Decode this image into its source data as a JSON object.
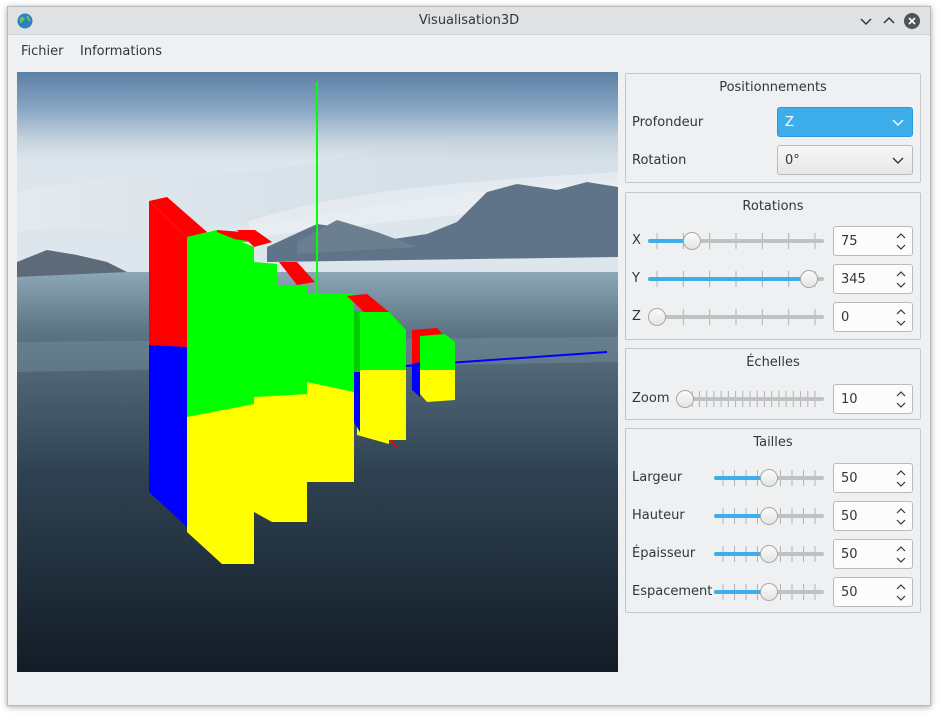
{
  "window": {
    "title": "Visualisation3D"
  },
  "menu": {
    "items": [
      "Fichier",
      "Informations"
    ]
  },
  "positionnements": {
    "title": "Positionnements",
    "profondeur": {
      "label": "Profondeur",
      "value": "Z"
    },
    "rotation": {
      "label": "Rotation",
      "value": "0°"
    }
  },
  "rotations": {
    "title": "Rotations",
    "x": {
      "label": "X",
      "value": "75",
      "fraction": 0.22
    },
    "y": {
      "label": "Y",
      "value": "345",
      "fraction": 0.96
    },
    "z": {
      "label": "Z",
      "value": "0",
      "fraction": 0.0
    }
  },
  "echelles": {
    "title": "Échelles",
    "zoom": {
      "label": "Zoom",
      "value": "10",
      "fraction": 0.0
    }
  },
  "tailles": {
    "title": "Tailles",
    "largeur": {
      "label": "Largeur",
      "value": "50",
      "fraction": 0.5
    },
    "hauteur": {
      "label": "Hauteur",
      "value": "50",
      "fraction": 0.5
    },
    "epaisseur": {
      "label": "Épaisseur",
      "value": "50",
      "fraction": 0.5
    },
    "espacement": {
      "label": "Espacement",
      "value": "50",
      "fraction": 0.5
    }
  },
  "colors": {
    "accent": "#3daee9",
    "bar_top": "#ff0000",
    "bar_front": "#00ff00",
    "bar_bottom": "#ffff00",
    "bar_side_low": "#0000ff"
  }
}
